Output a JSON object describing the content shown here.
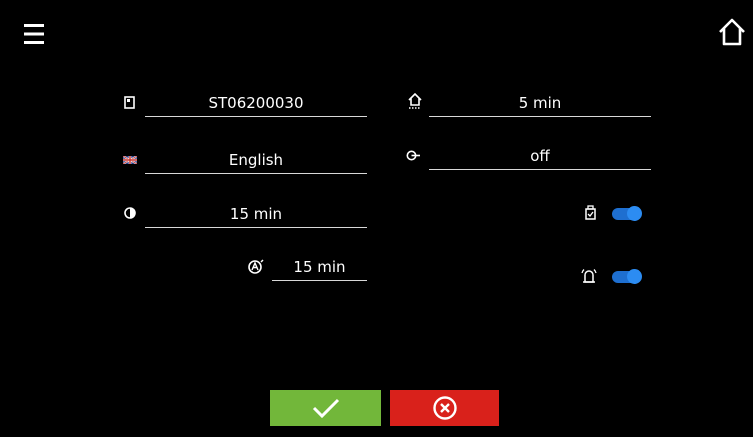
{
  "icons": {
    "menu": "hamburger-menu-icon",
    "home": "home-icon",
    "serial": "device-id-icon",
    "language": "uk-flag-icon",
    "brightness": "brightness-icon",
    "backlight_timer": "backlight-timer-icon",
    "screensaver": "screensaver-home-icon",
    "lock": "key-lock-icon",
    "usb": "usb-icon",
    "alarm": "alarm-icon",
    "confirm": "checkmark-icon",
    "cancel": "cancel-circle-x-icon"
  },
  "left_fields": {
    "serial_number": "ST06200030",
    "language": "English",
    "brightness_timeout": "15 min",
    "dim_timeout": "15 min"
  },
  "right_fields": {
    "return_home_timeout": "5 min",
    "lock": "off"
  },
  "toggles": {
    "usb_enabled": true,
    "alarm_sound_enabled": true
  },
  "colors": {
    "background": "#000000",
    "field_line": "#d8d8d8",
    "toggle_on": "#2c8cf2",
    "confirm_button": "#72b73a",
    "cancel_button": "#d9211b"
  }
}
